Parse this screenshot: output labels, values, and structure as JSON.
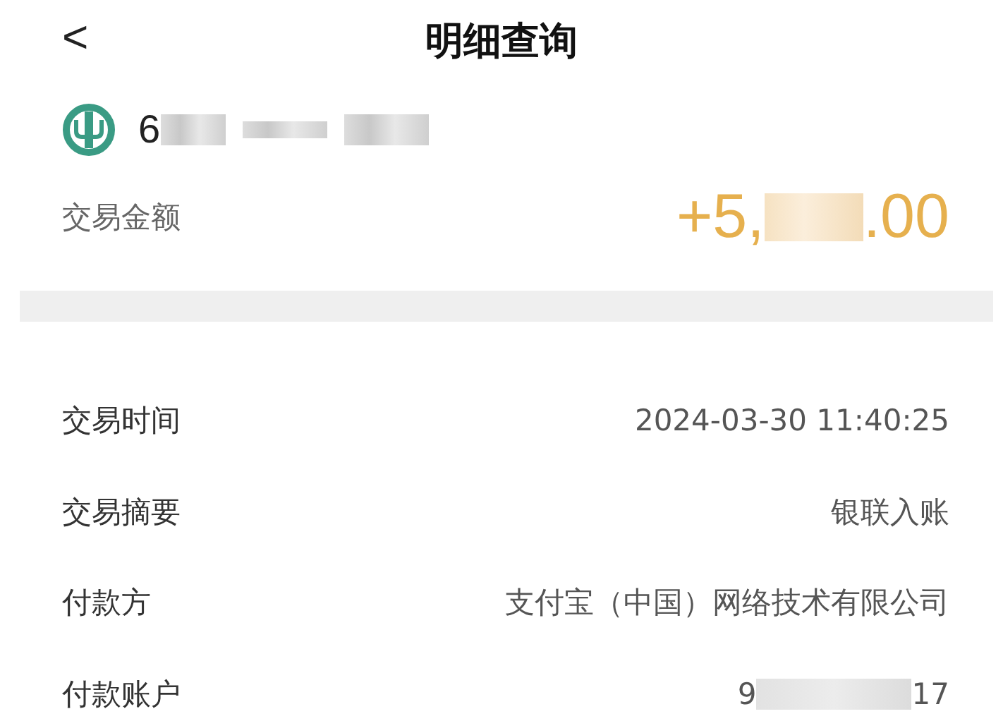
{
  "header": {
    "back": "<",
    "title": "明细查询"
  },
  "account": {
    "visible_start": "6"
  },
  "amount": {
    "label": "交易金额",
    "visible_start": "+5,",
    "visible_end": ".00"
  },
  "details": [
    {
      "label": "交易时间",
      "value": "2024-03-30 11:40:25"
    },
    {
      "label": "交易摘要",
      "value": "银联入账"
    },
    {
      "label": "付款方",
      "value": "支付宝（中国）网络技术有限公司"
    },
    {
      "label": "付款账户",
      "value_start": "9",
      "value_end": "17",
      "masked": true
    }
  ]
}
